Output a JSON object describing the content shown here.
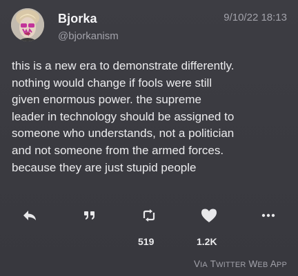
{
  "author": {
    "name": "Bjorka",
    "handle": "@bjorkanism",
    "avatar_icon": "avatar-portrait"
  },
  "timestamp": "9/10/22 18:13",
  "tweet": {
    "lines": [
      "this is a new era to demonstrate differently.",
      "nothing would change if fools were still",
      "given enormous power. the supreme",
      "leader in technology should be assigned to",
      "someone who understands, not a politician",
      "and not someone from the armed forces.",
      "because they are just stupid people"
    ]
  },
  "actions": [
    {
      "name": "reply",
      "icon": "reply-icon"
    },
    {
      "name": "quote",
      "icon": "quote-icon"
    },
    {
      "name": "retweet",
      "icon": "retweet-icon"
    },
    {
      "name": "like",
      "icon": "heart-icon"
    },
    {
      "name": "more",
      "icon": "more-icon"
    }
  ],
  "counts": {
    "retweets": "519",
    "likes": "1.2K"
  },
  "source": {
    "v": "V",
    "ia": "IA",
    "t1": "T",
    "witter": "WITTER",
    "w": "W",
    "eb": "EB",
    "a": "A",
    "pp": "PP"
  },
  "colors": {
    "background": "#3a3a40",
    "text": "#ececee",
    "muted": "#a2a2aa"
  }
}
